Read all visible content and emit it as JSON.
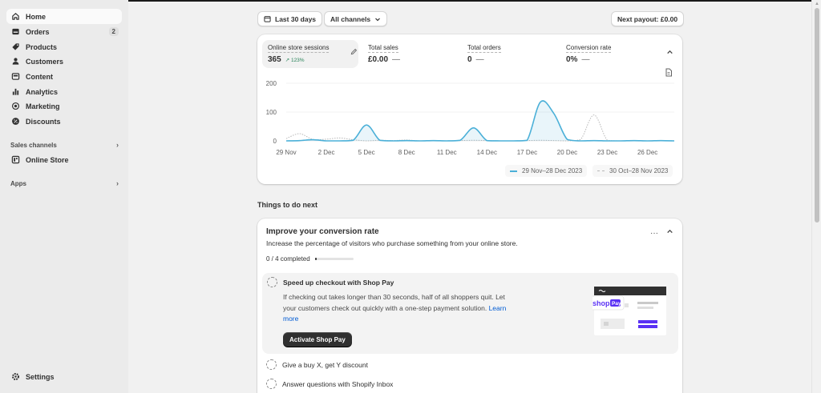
{
  "sidebar": {
    "items": [
      {
        "label": "Home",
        "icon": "home-icon",
        "active": true
      },
      {
        "label": "Orders",
        "icon": "orders-icon",
        "badge": "2"
      },
      {
        "label": "Products",
        "icon": "products-icon"
      },
      {
        "label": "Customers",
        "icon": "customers-icon"
      },
      {
        "label": "Content",
        "icon": "content-icon"
      },
      {
        "label": "Analytics",
        "icon": "analytics-icon"
      },
      {
        "label": "Marketing",
        "icon": "marketing-icon"
      },
      {
        "label": "Discounts",
        "icon": "discounts-icon"
      }
    ],
    "sales_channels_label": "Sales channels",
    "online_store_label": "Online Store",
    "apps_label": "Apps",
    "settings_label": "Settings"
  },
  "toolbar": {
    "date_range_label": "Last 30 days",
    "channels_label": "All channels",
    "next_payout_label": "Next payout: £0.00"
  },
  "metrics": [
    {
      "label": "Online store sessions",
      "value": "365",
      "change": "123%",
      "selected": true
    },
    {
      "label": "Total sales",
      "value": "£0.00",
      "dash": "—"
    },
    {
      "label": "Total orders",
      "value": "0",
      "dash": "—"
    },
    {
      "label": "Conversion rate",
      "value": "0%",
      "dash": "—"
    }
  ],
  "chart_data": {
    "type": "line",
    "x_tick_labels": [
      "29 Nov",
      "2 Dec",
      "5 Dec",
      "8 Dec",
      "11 Dec",
      "14 Dec",
      "17 Dec",
      "20 Dec",
      "23 Dec",
      "26 Dec"
    ],
    "y_tick_labels": [
      "200",
      "100",
      "0"
    ],
    "ylim": [
      0,
      200
    ],
    "grid": true,
    "series": [
      {
        "name": "29 Nov–28 Dec 2023",
        "style": "solid",
        "color": "#4bb0d8",
        "x": [
          "29 Nov",
          "30 Nov",
          "1 Dec",
          "2 Dec",
          "3 Dec",
          "4 Dec",
          "5 Dec",
          "6 Dec",
          "7 Dec",
          "8 Dec",
          "9 Dec",
          "10 Dec",
          "11 Dec",
          "12 Dec",
          "13 Dec",
          "14 Dec",
          "15 Dec",
          "16 Dec",
          "17 Dec",
          "18 Dec",
          "19 Dec",
          "20 Dec",
          "21 Dec",
          "22 Dec",
          "23 Dec",
          "24 Dec",
          "25 Dec",
          "26 Dec",
          "27 Dec",
          "28 Dec"
        ],
        "values": [
          0,
          1,
          4,
          0,
          0,
          2,
          55,
          2,
          0,
          1,
          0,
          1,
          0,
          2,
          45,
          1,
          0,
          0,
          2,
          135,
          95,
          5,
          0,
          1,
          0,
          0,
          1,
          0,
          1,
          0
        ]
      },
      {
        "name": "30 Oct–28 Nov 2023",
        "style": "dashed",
        "color": "#b8b8b8",
        "x": [
          "29 Nov",
          "30 Nov",
          "1 Dec",
          "2 Dec",
          "3 Dec",
          "4 Dec",
          "5 Dec",
          "6 Dec",
          "7 Dec",
          "8 Dec",
          "9 Dec",
          "10 Dec",
          "11 Dec",
          "12 Dec",
          "13 Dec",
          "14 Dec",
          "15 Dec",
          "16 Dec",
          "17 Dec",
          "18 Dec",
          "19 Dec",
          "20 Dec",
          "21 Dec",
          "22 Dec",
          "23 Dec",
          "24 Dec",
          "25 Dec",
          "26 Dec",
          "27 Dec",
          "28 Dec"
        ],
        "values": [
          8,
          25,
          5,
          6,
          10,
          4,
          0,
          2,
          1,
          3,
          0,
          1,
          0,
          1,
          2,
          1,
          0,
          0,
          1,
          2,
          1,
          0,
          5,
          90,
          2,
          0,
          1,
          0,
          0,
          0
        ]
      }
    ],
    "legend": [
      {
        "label": "29 Nov–28 Dec 2023",
        "style": "solid",
        "color": "#4bb0d8"
      },
      {
        "label": "30 Oct–28 Nov 2023",
        "style": "dashed",
        "color": "#b8b8b8"
      }
    ]
  },
  "things_to_do": {
    "heading": "Things to do next",
    "title": "Improve your conversion rate",
    "description": "Increase the percentage of visitors who purchase something from your online store.",
    "progress_text": "0 / 4 completed",
    "progress": 0.05,
    "featured": {
      "title": "Speed up checkout with Shop Pay",
      "text_line1": "If checking out takes longer than 30 seconds, half of all shoppers quit. Let",
      "text_line2": "your customers check out quickly with a one-step payment solution.",
      "link_text_a": "Learn",
      "link_text_b": "more",
      "button_label": "Activate Shop Pay",
      "illustration_brand": "shop",
      "illustration_badge": "Pay",
      "accent_color": "#5a31f4"
    },
    "tasks": [
      {
        "label": "Give a buy X, get Y discount"
      },
      {
        "label": "Answer questions with Shopify Inbox"
      }
    ],
    "more_actions": "···"
  }
}
